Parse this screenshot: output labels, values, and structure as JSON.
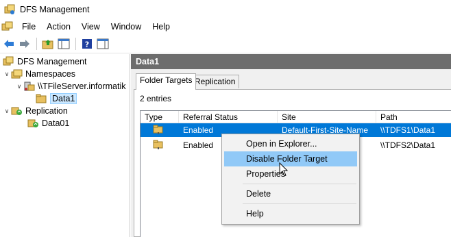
{
  "window": {
    "title": "DFS Management"
  },
  "menu": {
    "items": [
      "File",
      "Action",
      "View",
      "Window",
      "Help"
    ]
  },
  "toolbar": {
    "buttons": [
      "back-arrow-icon",
      "forward-arrow-icon",
      "up-folder-icon",
      "show-hide-tree-icon",
      "help-icon",
      "action-pane-icon"
    ]
  },
  "tree": {
    "root": "DFS Management",
    "namespaces": "Namespaces",
    "server": "\\\\TFileServer.informatik",
    "data1": "Data1",
    "replication": "Replication",
    "data01": "Data01"
  },
  "pane": {
    "header": "Data1",
    "tabs": [
      "Folder Targets",
      "Replication"
    ],
    "entries": "2 entries",
    "columns": [
      "Type",
      "Referral Status",
      "Site",
      "Path"
    ],
    "rows": [
      {
        "status": "Enabled",
        "site": "Default-First-Site-Name",
        "path": "\\\\TDFS1\\Data1"
      },
      {
        "status": "Enabled",
        "site": "",
        "path": "\\\\TDFS2\\Data1"
      }
    ]
  },
  "context_menu": {
    "items": [
      "Open in Explorer...",
      "Disable Folder Target",
      "Properties",
      "Delete",
      "Help"
    ],
    "highlighted": "Disable Folder Target"
  },
  "colors": {
    "selection": "#0078d7",
    "header_bar": "#6d6d6d",
    "menu_highlight": "#91c9f7"
  }
}
